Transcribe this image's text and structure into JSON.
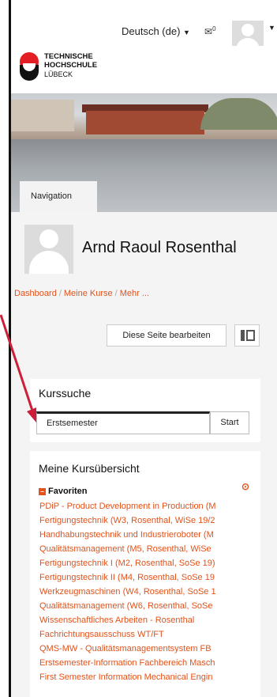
{
  "header": {
    "language": "Deutsch (de)",
    "messages_count": "0"
  },
  "logo": {
    "line1": "TECHNISCHE",
    "line2": "HOCHSCHULE",
    "line3": "LÜBECK"
  },
  "navigation_tab": "Navigation",
  "profile": {
    "name": "Arnd Raoul Rosenthal"
  },
  "breadcrumb": {
    "items": [
      "Dashboard",
      "Meine Kurse",
      "Mehr ..."
    ]
  },
  "edit_page_label": "Diese Seite bearbeiten",
  "course_search": {
    "title": "Kurssuche",
    "value": "Erstsemester",
    "button": "Start"
  },
  "course_overview": {
    "title": "Meine Kursübersicht",
    "section": "Favoriten",
    "courses": [
      "PDiP - Product Development in Production (M",
      "Fertigungstechnik (W3, Rosenthal, WiSe 19/2",
      "Handhabungstechnik und Industrieroboter (M",
      "Qualitätsmanagement (M5, Rosenthal, WiSe",
      "Fertigungstechnik I (M2, Rosenthal, SoSe 19)",
      "Fertigungstechnik II (M4, Rosenthal, SoSe 19",
      "Werkzeugmaschinen (W4, Rosenthal, SoSe 1",
      "Qualitätsmanagement (W6, Rosenthal, SoSe",
      "Wissenschaftliches Arbeiten - Rosenthal",
      "Fachrichtungsausschuss WT/FT",
      "QMS-MW - Qualitätsmanagementsystem FB",
      "Erstsemester-Information Fachbereich Masch",
      "First Semester Information Mechanical Engin"
    ]
  },
  "colors": {
    "link": "#e2521a",
    "arrow": "#cc1f3a"
  }
}
